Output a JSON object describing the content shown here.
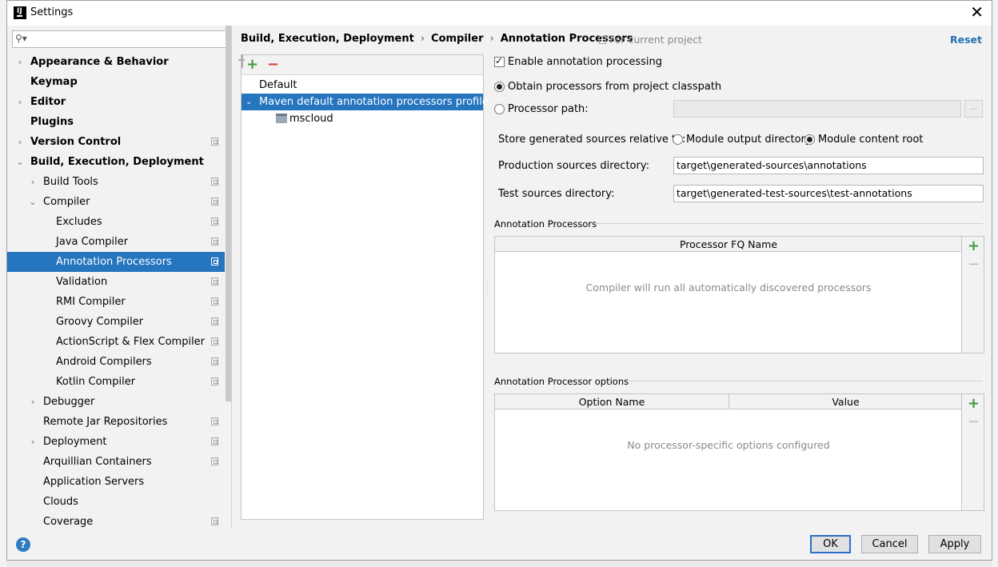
{
  "window": {
    "title": "Settings",
    "close_label": "✕"
  },
  "search": {
    "placeholder": "",
    "icon": "search-icon"
  },
  "sidebar": {
    "items": [
      {
        "label": "Appearance & Behavior",
        "level": 0,
        "bold": true,
        "arrow": "›",
        "copy": false
      },
      {
        "label": "Keymap",
        "level": 0,
        "bold": true,
        "arrow": "",
        "copy": false
      },
      {
        "label": "Editor",
        "level": 0,
        "bold": true,
        "arrow": "›",
        "copy": false
      },
      {
        "label": "Plugins",
        "level": 0,
        "bold": true,
        "arrow": "",
        "copy": false
      },
      {
        "label": "Version Control",
        "level": 0,
        "bold": true,
        "arrow": "›",
        "copy": true
      },
      {
        "label": "Build, Execution, Deployment",
        "level": 0,
        "bold": true,
        "arrow": "⌄",
        "copy": false
      },
      {
        "label": "Build Tools",
        "level": 1,
        "bold": false,
        "arrow": "›",
        "copy": true
      },
      {
        "label": "Compiler",
        "level": 1,
        "bold": false,
        "arrow": "⌄",
        "copy": true
      },
      {
        "label": "Excludes",
        "level": 2,
        "bold": false,
        "arrow": "",
        "copy": true
      },
      {
        "label": "Java Compiler",
        "level": 2,
        "bold": false,
        "arrow": "",
        "copy": true
      },
      {
        "label": "Annotation Processors",
        "level": 2,
        "bold": false,
        "arrow": "",
        "copy": true,
        "selected": true
      },
      {
        "label": "Validation",
        "level": 2,
        "bold": false,
        "arrow": "",
        "copy": true
      },
      {
        "label": "RMI Compiler",
        "level": 2,
        "bold": false,
        "arrow": "",
        "copy": true
      },
      {
        "label": "Groovy Compiler",
        "level": 2,
        "bold": false,
        "arrow": "",
        "copy": true
      },
      {
        "label": "ActionScript & Flex Compiler",
        "level": 2,
        "bold": false,
        "arrow": "",
        "copy": true
      },
      {
        "label": "Android Compilers",
        "level": 2,
        "bold": false,
        "arrow": "",
        "copy": true
      },
      {
        "label": "Kotlin Compiler",
        "level": 2,
        "bold": false,
        "arrow": "",
        "copy": true
      },
      {
        "label": "Debugger",
        "level": 1,
        "bold": false,
        "arrow": "›",
        "copy": false
      },
      {
        "label": "Remote Jar Repositories",
        "level": 1,
        "bold": false,
        "arrow": "",
        "copy": true
      },
      {
        "label": "Deployment",
        "level": 1,
        "bold": false,
        "arrow": "›",
        "copy": true
      },
      {
        "label": "Arquillian Containers",
        "level": 1,
        "bold": false,
        "arrow": "",
        "copy": true
      },
      {
        "label": "Application Servers",
        "level": 1,
        "bold": false,
        "arrow": "",
        "copy": false
      },
      {
        "label": "Clouds",
        "level": 1,
        "bold": false,
        "arrow": "",
        "copy": false
      },
      {
        "label": "Coverage",
        "level": 1,
        "bold": false,
        "arrow": "",
        "copy": true
      }
    ]
  },
  "header": {
    "breadcrumb": [
      "Build, Execution, Deployment",
      "Compiler",
      "Annotation Processors"
    ],
    "separator": "›",
    "scope": "For current project",
    "reset": "Reset"
  },
  "profiles": {
    "toolbar": {
      "add": "+",
      "remove": "−"
    },
    "items": [
      {
        "label": "Default"
      },
      {
        "label": "Maven default annotation processors profile",
        "selected": true,
        "chevron": "⌄"
      },
      {
        "label": "mscloud",
        "module": true
      }
    ]
  },
  "settings": {
    "enable_label": "Enable annotation processing",
    "enable_checked": true,
    "obtain_label": "Obtain processors from project classpath",
    "path_label": "Processor path:",
    "path_value": "",
    "browse_label": "...",
    "store_label": "Store generated sources relative to:",
    "module_output_label": "Module output directory",
    "module_content_label": "Module content root",
    "prod_label": "Production sources directory:",
    "prod_value": "target\\generated-sources\\annotations",
    "test_label": "Test sources directory:",
    "test_value": "target\\generated-test-sources\\test-annotations"
  },
  "processors": {
    "title": "Annotation Processors",
    "column": "Processor FQ Name",
    "empty": "Compiler will run all automatically discovered processors",
    "add": "+",
    "remove": "−"
  },
  "options": {
    "title": "Annotation Processor options",
    "columns": [
      "Option Name",
      "Value"
    ],
    "empty": "No processor-specific options configured",
    "add": "+",
    "remove": "−"
  },
  "footer": {
    "help": "?",
    "ok": "OK",
    "cancel": "Cancel",
    "apply": "Apply"
  },
  "colors": {
    "selection": "#2675bf",
    "link": "#2470b3",
    "add": "#3c9b3c",
    "remove": "#d3433c"
  }
}
